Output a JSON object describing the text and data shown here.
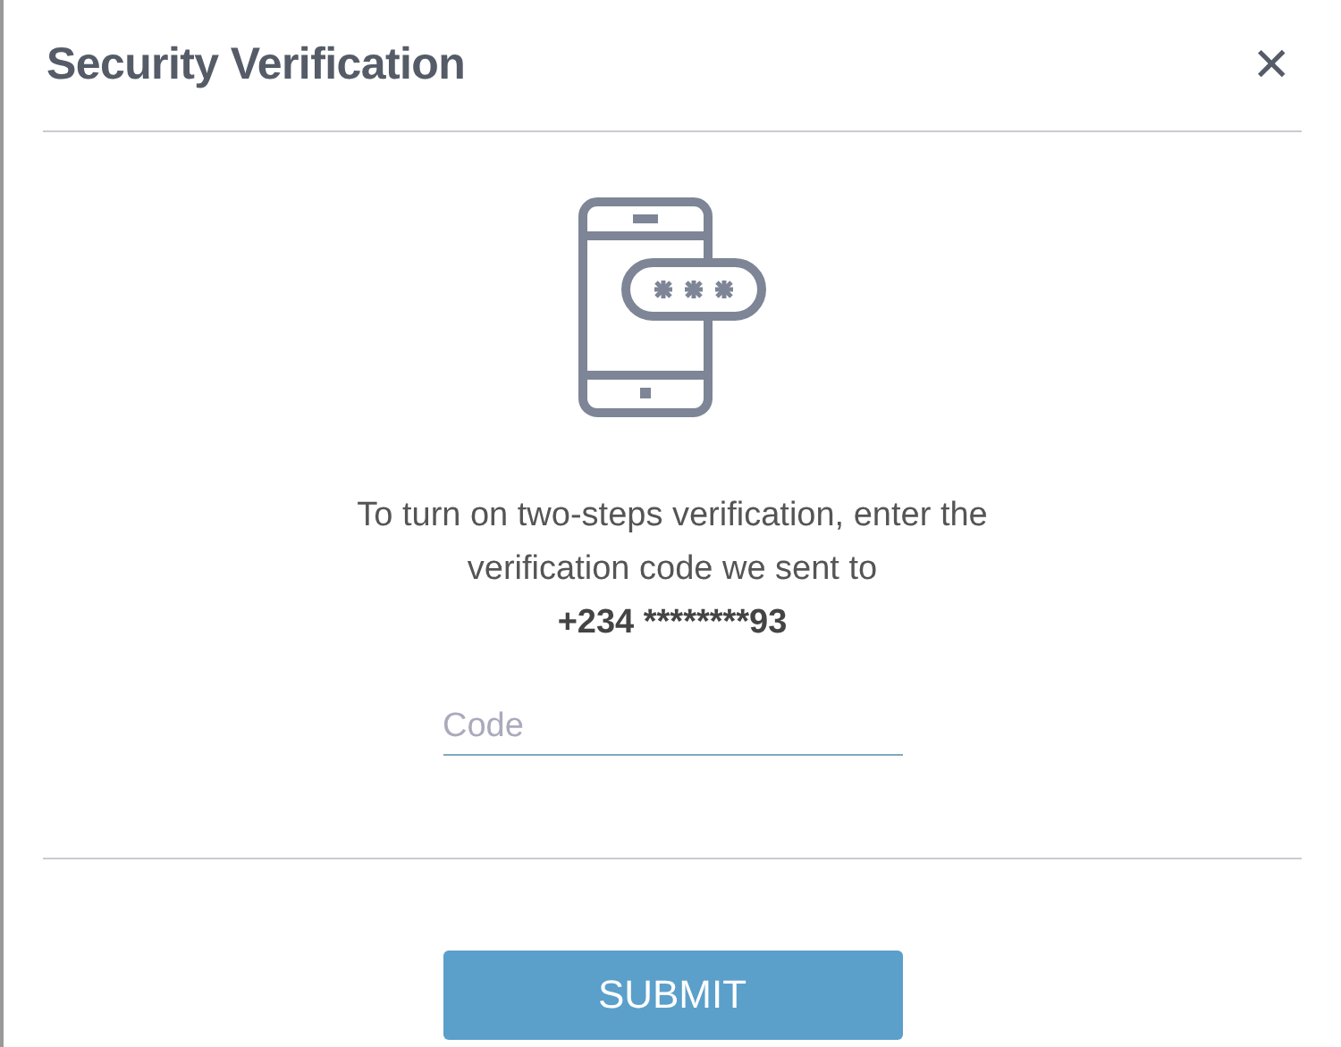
{
  "dialog": {
    "title": "Security Verification",
    "close": "✕"
  },
  "message": "To turn on two-steps verification, enter the verification code we sent to",
  "phone": "+234 ********93",
  "code_field": {
    "placeholder": "Code"
  },
  "submit": "SUBMIT"
}
